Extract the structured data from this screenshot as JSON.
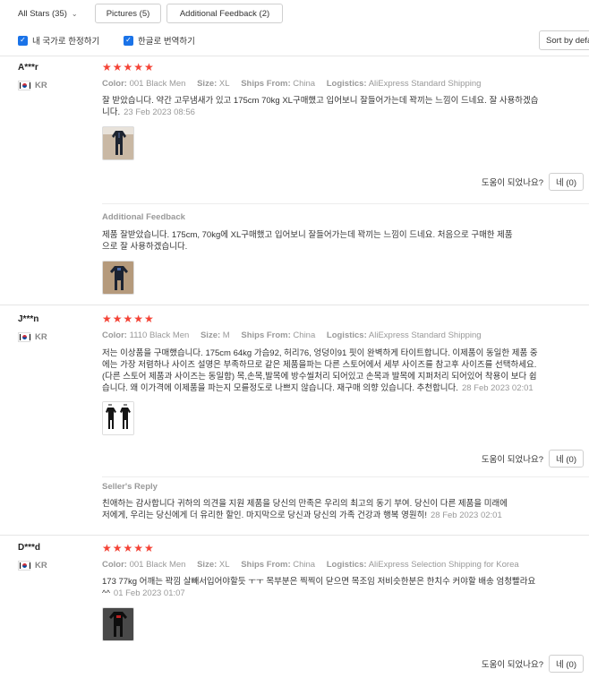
{
  "filters": {
    "stars_select": "All Stars (35)",
    "pictures_label": "Pictures (5)",
    "additional_feedback_label": "Additional Feedback (2)",
    "country_only_label": "내 국가로 한정하기",
    "translate_label": "한글로 번역하기",
    "sort_label": "Sort by default"
  },
  "labels": {
    "color": "Color:",
    "size": "Size:",
    "ships_from": "Ships From:",
    "logistics": "Logistics:",
    "helpful_question": "도움이 되었나요?",
    "stars": "★★★★★"
  },
  "reviews": [
    {
      "reviewer": "A***r",
      "country": "KR",
      "color": "001 Black Men",
      "size": "XL",
      "ships_from": "China",
      "logistics": "AliExpress Standard Shipping",
      "text_line1": "잘 받았습니다. 약간 고무냄새가 있고 175cm 70kg XL구매했고 입어보니 잘들어가는데 꽉끼는 느낌이 드네요. 잘 사용하겠습",
      "text_line2": "니다.",
      "date": "23 Feb 2023 08:56",
      "helpful_count": "네 (0)",
      "additional_label": "Additional Feedback",
      "additional_line1": "제품 잘받았습니다. 175cm, 70kg에 XL구매했고 입어보니 잘들어가는데 꽉끼는 느낌이 드네요. 처음으로 구매한 제품",
      "additional_line2": "으로 잘 사용하겠습니다."
    },
    {
      "reviewer": "J***n",
      "country": "KR",
      "color": "1110 Black Men",
      "size": "M",
      "ships_from": "China",
      "logistics": "AliExpress Standard Shipping",
      "text_line1": "저는 이상품을 구매했습니다. 175cm 64kg 가슴92, 허리76, 엉덩이91 핏이 완벽하게 타이트합니다. 이제품이 동일한 제품 중",
      "text_line2": "에는 가장 저렴하나 사이즈 설명은 부족하므로 같은 제품을파는 다른 스토어에서 세부 사이즈를 참고후 사이즈를 선택하세요.",
      "text_line3": "(다른 스토어 제품과 사이즈는 동일함) 목,손목,발목에 방수씰처리 되어있고 손목과 발목에 지퍼처리 되어있어 착용이 보다 쉽",
      "text_line4": "습니다. 왜 이가격에 이제품을 파는지 모를정도로 나쁘지 않습니다. 재구매 의향 있습니다. 추천합니다.",
      "date": "28 Feb 2023 02:01",
      "helpful_count": "네 (0)",
      "seller_label": "Seller's Reply",
      "seller_line1": "친애하는 감사합니다 귀하의 의견을 지원 제품을 당신의 만족은 우리의 최고의 동기 부여. 당신이 다른 제품을 미래에",
      "seller_line2": "저에게, 우리는 당신에게 더 유리한 할인. 마지막으로 당신과 당신의 가족 건강과 행복 영원히!",
      "seller_date": "28 Feb 2023 02:01"
    },
    {
      "reviewer": "D***d",
      "country": "KR",
      "color": "001 Black Men",
      "size": "XL",
      "ships_from": "China",
      "logistics": "AliExpress Selection Shipping for Korea",
      "text_line1": "173 77kg 어깨는 꽉낌 살빼서입어야할듯 ㅜㅜ 목부분은 찍찍이 닫으면 목조임 저비슷한분은 한치수 커야할 배송 엄청빨라요",
      "text_line2": "^^",
      "date": "01 Feb 2023 01:07",
      "helpful_count": "네 (0)"
    }
  ]
}
